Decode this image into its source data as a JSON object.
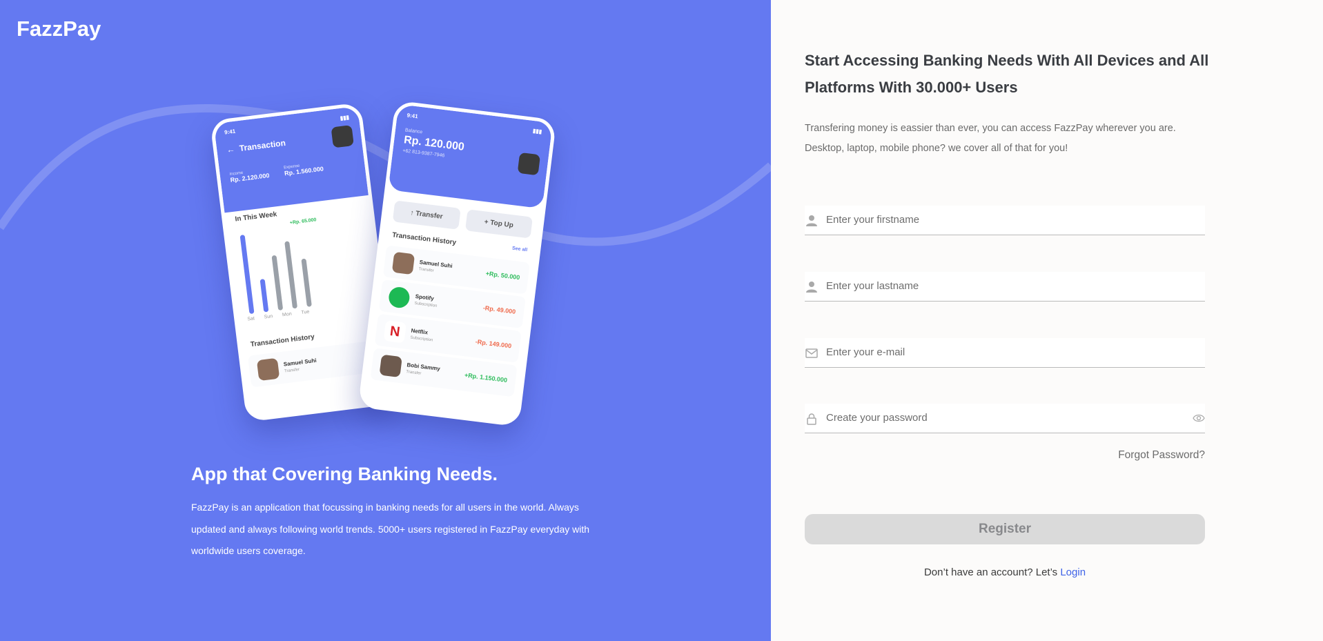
{
  "brand": "FazzPay",
  "hero": {
    "title": "App that Covering Banking Needs.",
    "text": "FazzPay is an application that focussing in banking needs for all users in the world. Always updated and always following world trends. 5000+ users registered in FazzPay everyday with worldwide users coverage."
  },
  "phone1": {
    "time": "9:41",
    "title": "Transaction",
    "income_label": "Income",
    "income": "Rp. 2.120.000",
    "expense_label": "Expense",
    "expense": "Rp. 1.560.000",
    "week_label": "In This Week",
    "tooltip": "+Rp. 65.000",
    "days": [
      "Sat",
      "Sun",
      "Mon",
      "Tue"
    ],
    "history_label": "Transaction History",
    "row_name": "Samuel Suhi",
    "row_sub": "Transfer"
  },
  "phone2": {
    "time": "9:41",
    "balance_label": "Balance",
    "balance": "Rp. 120.000",
    "phone": "+62 813-9387-7946",
    "transfer": "Transfer",
    "topup": "Top Up",
    "history_label": "Transaction History",
    "see_all": "See all",
    "rows": [
      {
        "name": "Samuel Suhi",
        "sub": "Transfer",
        "amount": "+Rp. 50.000",
        "type": "pos"
      },
      {
        "name": "Spotify",
        "sub": "Subscription",
        "amount": "-Rp. 49.000",
        "type": "neg"
      },
      {
        "name": "Netflix",
        "sub": "Subscription",
        "amount": "-Rp. 149.000",
        "type": "neg"
      },
      {
        "name": "Bobi Sammy",
        "sub": "Transfer",
        "amount": "+Rp. 1.150.000",
        "type": "pos"
      }
    ]
  },
  "form": {
    "title": "Start Accessing Banking Needs With All Devices and All Platforms With 30.000+ Users",
    "description": "Transfering money is eassier than ever, you can access FazzPay wherever you are. Desktop, laptop, mobile phone? we cover all of that for you!",
    "firstname_placeholder": "Enter your firstname",
    "lastname_placeholder": "Enter your lastname",
    "email_placeholder": "Enter your e-mail",
    "password_placeholder": "Create your password",
    "forgot": "Forgot Password?",
    "register": "Register",
    "account_text": "Don’t have an account? Let’s ",
    "login": "Login"
  },
  "colors": {
    "primary": "#6479f1",
    "positive": "#2ebc5c",
    "negative": "#ef6a4c",
    "link": "#3f63e7"
  }
}
